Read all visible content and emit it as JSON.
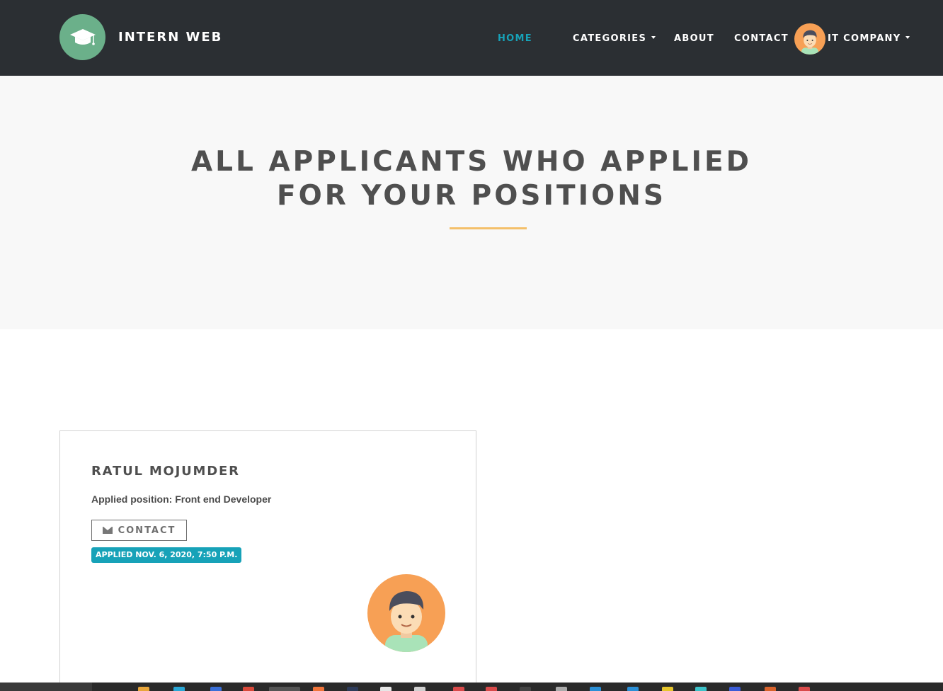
{
  "brand": {
    "name": "INTERN WEB",
    "logo_icon": "graduation-cap-icon"
  },
  "nav": {
    "home": "HOME",
    "categories": "CATEGORIES",
    "about": "ABOUT",
    "contact": "CONTACT",
    "account": "IT COMPANY"
  },
  "hero": {
    "title_line1": "ALL APPLICANTS WHO APPLIED",
    "title_line2": "FOR YOUR POSITIONS"
  },
  "applicants": [
    {
      "name": "RATUL MOJUMDER",
      "position": "Applied position: Front end Developer",
      "contact_label": "CONTACT",
      "applied": "APPLIED NOV. 6, 2020, 7:50 P.M."
    }
  ],
  "colors": {
    "navbar": "#2b2f33",
    "accent": "#17a2b8",
    "brand_logo": "#6bb08a",
    "hero_underline": "#f4c06a",
    "avatar_bg": "#f7a055"
  }
}
